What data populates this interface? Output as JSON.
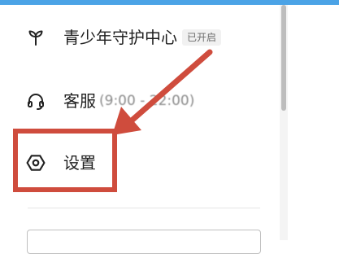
{
  "colors": {
    "top_strip": "#4ba3e6",
    "annotation": "#cf4c3d"
  },
  "menu": {
    "items": [
      {
        "icon": "sprout-icon",
        "label": "青少年守护中心",
        "badge": "已开启"
      },
      {
        "icon": "headset-icon",
        "label": "客服",
        "detail": "(9:00 - 22:00)"
      },
      {
        "icon": "settings-icon",
        "label": "设置"
      }
    ]
  }
}
